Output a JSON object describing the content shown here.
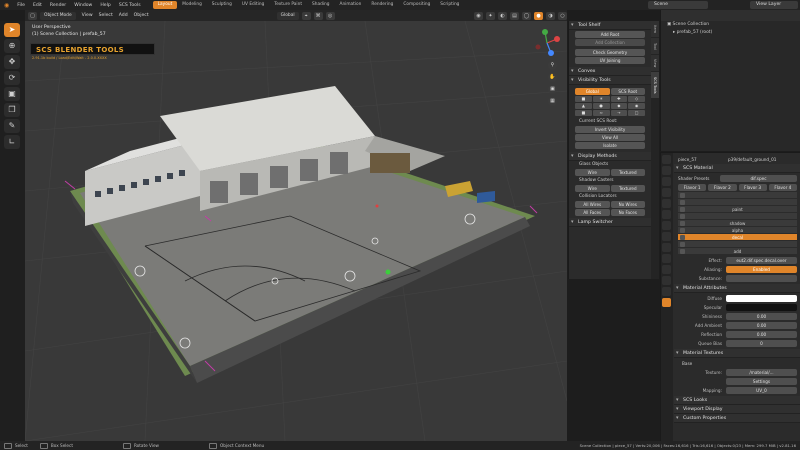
{
  "topbar": {
    "menus": [
      "File",
      "Edit",
      "Render",
      "Window",
      "Help",
      "SCS Tools"
    ],
    "workspaces": [
      "Layout",
      "Modeling",
      "Sculpting",
      "UV Editing",
      "Texture Paint",
      "Shading",
      "Animation",
      "Rendering",
      "Compositing",
      "Scripting"
    ],
    "active_workspace": "Layout",
    "scene_name": "Scene",
    "view_layer": "View Layer"
  },
  "viewport_header": {
    "mode": "Object Mode",
    "menus": [
      "View",
      "Select",
      "Add",
      "Object"
    ],
    "orientation": "Global"
  },
  "viewport": {
    "perspective_label": "User Perspective",
    "collection_label": "(1) Scene Collection | prefab_57",
    "scs_banner": "SCS BLENDER TOOLS",
    "scs_version_line": "2.91.1b build / Load/Edit/Wait - 2.0.0.XXXX"
  },
  "npanel": {
    "tool_shelf": "Tool Shelf",
    "tool_shelf_buttons": [
      "Add Root",
      "Add Collection",
      "Check Geometry",
      "UV Joining"
    ],
    "convex": "Convex",
    "visibility_tools": "Visibility Tools",
    "vis_tabs": [
      "Global",
      "SCS Root"
    ],
    "current_root": "Current SCS Root:",
    "current_root_buttons": [
      "Invert Visibility",
      "View All",
      "Isolate"
    ],
    "display_methods": "Display Methods",
    "glass_objects": "Glass Objects",
    "shadow_casters": "Shadow Casters",
    "collision_locators": "Collision Locators",
    "wire_textured": [
      "Wire",
      "Textured"
    ],
    "collision_buttons": [
      "All Wires",
      "No Wires",
      "All Faces",
      "No Faces"
    ],
    "lamp_switcher": "Lamp Switcher",
    "tabs": [
      "Item",
      "Tool",
      "View",
      "SCS Tools"
    ]
  },
  "outliner": {
    "rows": [
      "Scene Collection",
      "prefab_57 (root)"
    ]
  },
  "props": {
    "object_name": "piece_57",
    "material_name": "p39/default_ground_01",
    "scs_material": "SCS Material",
    "shader_presets_label": "Shader Presets",
    "shader_preset_value": "dif.spec",
    "flavor_checks": [
      "Flavor 1",
      "Flavor 2",
      "Flavor 3",
      "Flavor 4"
    ],
    "flavor_list": [
      "",
      "",
      "paint",
      "",
      "shadow",
      "alpha",
      "decal",
      "",
      "add"
    ],
    "selected_flavor": "decal",
    "effect_label": "Effect:",
    "effect_value": "eut2.dif.spec.decal.over",
    "aliasing_label": "Aliasing:",
    "aliasing_value": "Enabled",
    "substance_label": "Substance:",
    "substance_value": "",
    "material_attributes": "Material Attributes",
    "attrs": [
      {
        "label": "Diffuse",
        "value": ""
      },
      {
        "label": "Specular",
        "value": ""
      },
      {
        "label": "Shininess",
        "value": "0.00"
      },
      {
        "label": "Add Ambient",
        "value": "0.00"
      },
      {
        "label": "Reflection",
        "value": "0.00"
      },
      {
        "label": "Queue Bias",
        "value": "0"
      }
    ],
    "material_textures": "Material Textures",
    "base_label": "Base",
    "texture_label": "Texture:",
    "texture_value": "/material/...",
    "settings_label": "Settings",
    "mapping_label": "Mapping:",
    "mapping_value": "UV_0",
    "scs_looks": "SCS Looks",
    "viewport_display": "Viewport Display",
    "custom_properties": "Custom Properties"
  },
  "statusbar": {
    "items": [
      "Select",
      "Box Select",
      "Rotate View",
      "Object Context Menu"
    ],
    "stats": "Scene Collection | piece_57 | Verts:20,006 | Faces:16,616 | Tris:16,616 | Objects:0/23 | Mem: 299.7 MiB | v2.81.16"
  },
  "colors": {
    "accent": "#e0852a",
    "scs_orange": "#e7a32f"
  }
}
